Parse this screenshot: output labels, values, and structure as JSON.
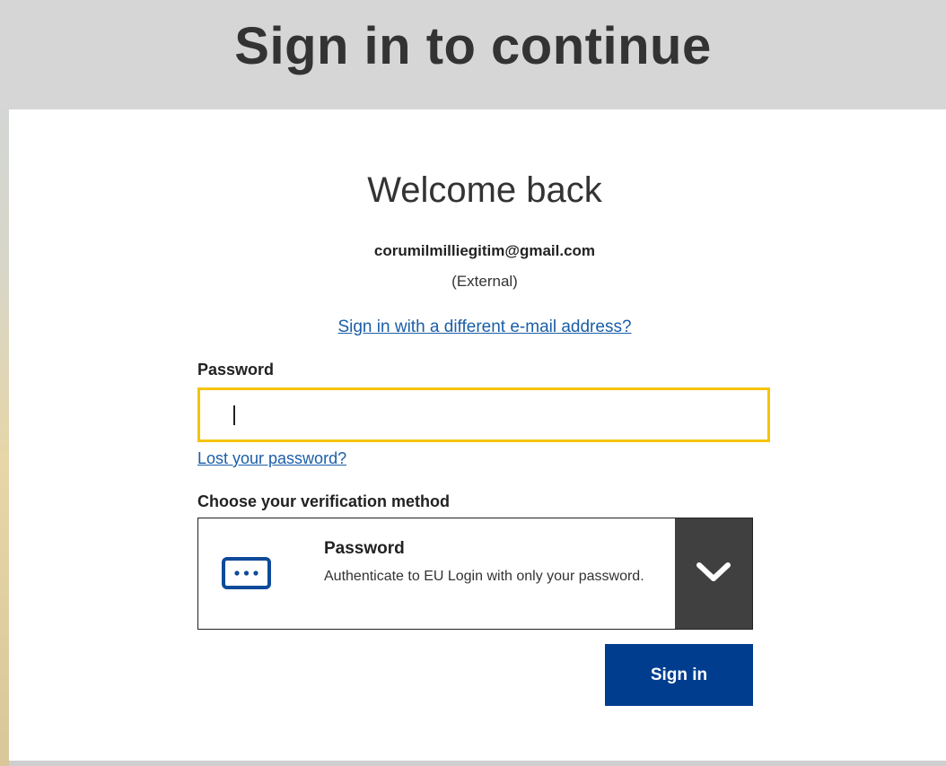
{
  "header": {
    "title": "Sign in to continue"
  },
  "login": {
    "welcome": "Welcome back",
    "email": "corumilmilliegitim@gmail.com",
    "account_type": "(External)",
    "different_email_link": "Sign in with a different e-mail address?",
    "password_label": "Password",
    "password_value": "",
    "lost_password_link": "Lost your password?",
    "verification_label": "Choose your verification method",
    "verification_method": {
      "title": "Password",
      "description": "Authenticate to EU Login with only your password.",
      "icon": "password-dots-icon",
      "dropdown_icon": "chevron-down-icon"
    },
    "signin_button": "Sign in"
  },
  "colors": {
    "accent_blue": "#003d8f",
    "focus_yellow": "#f5c400",
    "link_blue": "#1a5ea8",
    "dropdown_dark": "#404040"
  }
}
